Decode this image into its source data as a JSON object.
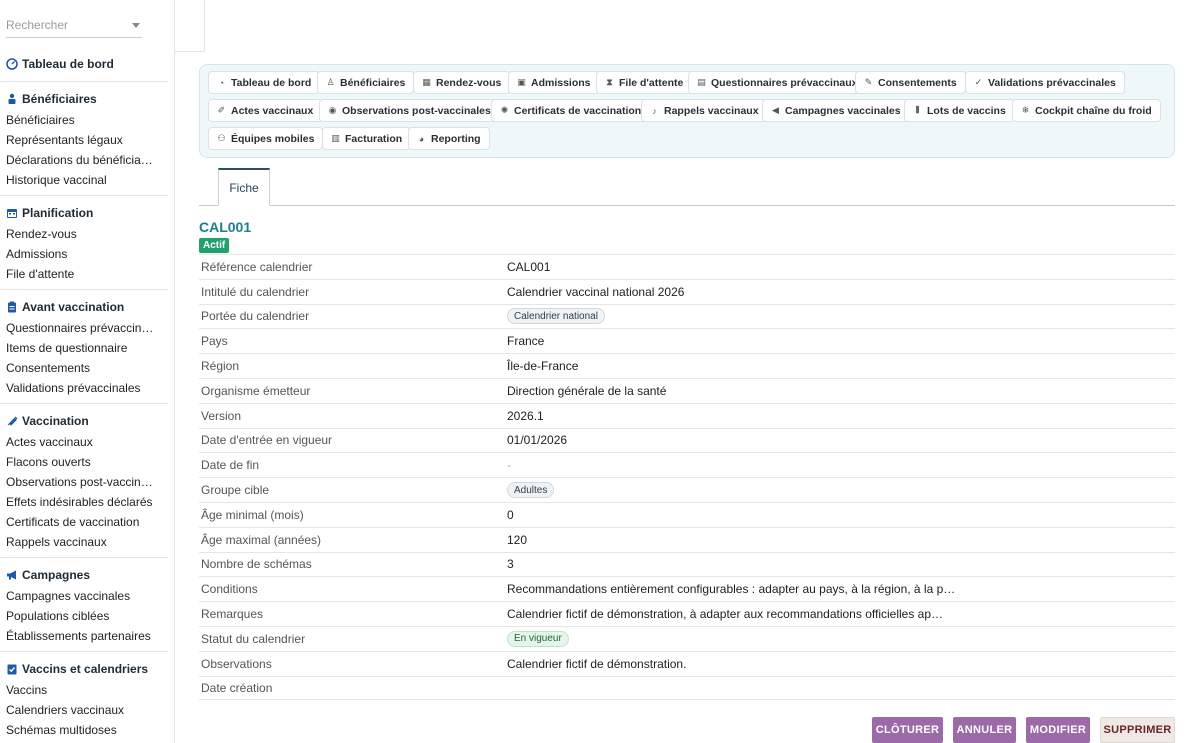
{
  "search": {
    "placeholder": "Rechercher"
  },
  "sidebar": {
    "dashboard": "Tableau de bord",
    "sections": [
      {
        "title": "Bénéficiaires",
        "icon": "person-icon",
        "items": [
          "Bénéficiaires",
          "Représentants légaux",
          "Déclarations du bénéficia…",
          "Historique vaccinal"
        ]
      },
      {
        "title": "Planification",
        "icon": "calendar-icon",
        "items": [
          "Rendez-vous",
          "Admissions",
          "File d'attente"
        ]
      },
      {
        "title": "Avant vaccination",
        "icon": "clipboard-icon",
        "items": [
          "Questionnaires prévaccin…",
          "Items de questionnaire",
          "Consentements",
          "Validations prévaccinales"
        ]
      },
      {
        "title": "Vaccination",
        "icon": "syringe-icon",
        "items": [
          "Actes vaccinaux",
          "Flacons ouverts",
          "Observations post-vaccin…",
          "Effets indésirables déclarés",
          "Certificats de vaccination",
          "Rappels vaccinaux"
        ]
      },
      {
        "title": "Campagnes",
        "icon": "megaphone-icon",
        "items": [
          "Campagnes vaccinales",
          "Populations ciblées",
          "Établissements partenaires"
        ]
      },
      {
        "title": "Vaccins et calendriers",
        "icon": "checklist-icon",
        "items": [
          "Vaccins",
          "Calendriers vaccinaux",
          "Schémas multidoses"
        ]
      }
    ]
  },
  "toolbar": {
    "buttons": [
      {
        "label": "Tableau de bord",
        "icon": "dashboard-icon"
      },
      {
        "label": "Bénéficiaires",
        "icon": "person-icon"
      },
      {
        "label": "Rendez-vous",
        "icon": "calendar-icon"
      },
      {
        "label": "Admissions",
        "icon": "clipboard-icon"
      },
      {
        "label": "File d'attente",
        "icon": "hourglass-icon"
      },
      {
        "label": "Questionnaires prévaccinaux",
        "icon": "clipboard-icon"
      },
      {
        "label": "Consentements",
        "icon": "signature-icon"
      },
      {
        "label": "Validations prévaccinales",
        "icon": "user-check-icon"
      },
      {
        "label": "Actes vaccinaux",
        "icon": "syringe-icon"
      },
      {
        "label": "Observations post-vaccinales",
        "icon": "eye-icon"
      },
      {
        "label": "Certificats de vaccination",
        "icon": "certificate-icon"
      },
      {
        "label": "Rappels vaccinaux",
        "icon": "bell-icon"
      },
      {
        "label": "Campagnes vaccinales",
        "icon": "megaphone-icon"
      },
      {
        "label": "Lots de vaccins",
        "icon": "barcode-icon"
      },
      {
        "label": "Cockpit chaîne du froid",
        "icon": "snowflake-icon"
      },
      {
        "label": "Équipes mobiles",
        "icon": "team-icon"
      },
      {
        "label": "Facturation",
        "icon": "invoice-icon"
      },
      {
        "label": "Reporting",
        "icon": "pie-chart-icon"
      }
    ]
  },
  "tabs": {
    "active": "Fiche"
  },
  "record": {
    "title": "CAL001",
    "status_badge": "Actif",
    "fields": [
      {
        "label": "Référence calendrier",
        "value": "CAL001",
        "kind": "text"
      },
      {
        "label": "Intitulé du calendrier",
        "value": "Calendrier vaccinal national 2026",
        "kind": "text"
      },
      {
        "label": "Portée du calendrier",
        "value": "Calendrier national",
        "kind": "pill"
      },
      {
        "label": "Pays",
        "value": "France",
        "kind": "text"
      },
      {
        "label": "Région",
        "value": "Île-de-France",
        "kind": "text"
      },
      {
        "label": "Organisme émetteur",
        "value": "Direction générale de la santé",
        "kind": "text"
      },
      {
        "label": "Version",
        "value": "2026.1",
        "kind": "text"
      },
      {
        "label": "Date d'entrée en vigueur",
        "value": "01/01/2026",
        "kind": "text"
      },
      {
        "label": "Date de fin",
        "value": "-",
        "kind": "dash"
      },
      {
        "label": "Groupe cible",
        "value": "Adultes",
        "kind": "pill"
      },
      {
        "label": "Âge minimal (mois)",
        "value": "0",
        "kind": "text"
      },
      {
        "label": "Âge maximal (années)",
        "value": "120",
        "kind": "text"
      },
      {
        "label": "Nombre de schémas",
        "value": "3",
        "kind": "text"
      },
      {
        "label": "Conditions",
        "value": "Recommandations entièrement configurables : adapter au pays, à la région, à la p…",
        "kind": "text"
      },
      {
        "label": "Remarques",
        "value": "Calendrier fictif de démonstration, à adapter aux recommandations officielles ap…",
        "kind": "text"
      },
      {
        "label": "Statut du calendrier",
        "value": "En vigueur",
        "kind": "pill-green"
      },
      {
        "label": "Observations",
        "value": "Calendrier fictif de démonstration.",
        "kind": "text"
      },
      {
        "label": "Date création",
        "value": "",
        "kind": "text"
      }
    ]
  },
  "actions": {
    "close": "CLÔTURER",
    "cancel": "ANNULER",
    "edit": "MODIFIER",
    "delete": "SUPPRIMER"
  }
}
